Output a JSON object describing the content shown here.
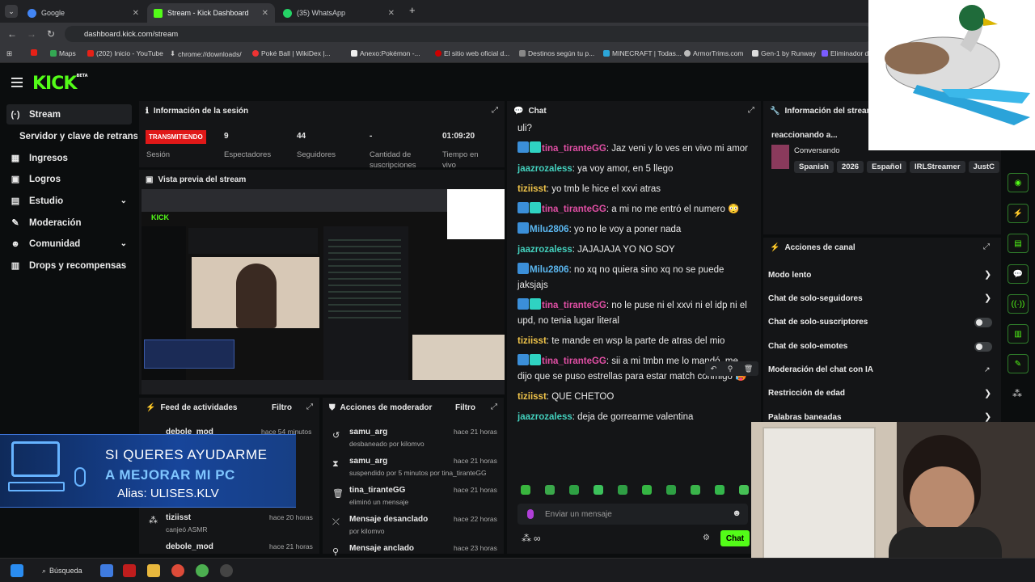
{
  "browser": {
    "tabs": [
      {
        "label": "Google",
        "color": "#4285f4"
      },
      {
        "label": "Stream - Kick Dashboard",
        "color": "#53fc18"
      },
      {
        "label": "(35) WhatsApp",
        "color": "#25d366"
      }
    ],
    "new_tab": "+",
    "url": "dashboard.kick.com/stream",
    "bookmarks": [
      "Maps",
      "(202) Inicio - YouTube",
      "chrome://downloads/",
      "Poké Ball | WikiDex |...",
      "Anexo:Pokémon -...",
      "El sitio web oficial d...",
      "Destinos según tu p...",
      "MINECRAFT | Todas...",
      "ArmorTrims.com",
      "Gen-1 by Runway",
      "Eliminador d"
    ]
  },
  "kick": {
    "logo": "KICK",
    "logo_badge": "BETA",
    "sidebar": [
      {
        "label": "Stream",
        "icon": "(·)"
      },
      {
        "label": "Servidor y clave de retransmisión",
        "icon": ""
      },
      {
        "label": "Ingresos",
        "icon": "▦"
      },
      {
        "label": "Logros",
        "icon": "▣"
      },
      {
        "label": "Estudio",
        "icon": "▤",
        "chevron": "⌄"
      },
      {
        "label": "Moderación",
        "icon": "✎"
      },
      {
        "label": "Comunidad",
        "icon": "☻",
        "chevron": "⌄"
      },
      {
        "label": "Drops y recompensas",
        "icon": "▥"
      }
    ],
    "session": {
      "title": "Información de la sesión",
      "live_label": "TRANSMITIENDO",
      "session_label": "Sesión",
      "stats": [
        {
          "value": "9",
          "label": "Espectadores"
        },
        {
          "value": "44",
          "label": "Seguidores"
        },
        {
          "value": "-",
          "label": "Cantidad de suscripciones"
        },
        {
          "value": "01:09:20",
          "label": "Tiempo en vivo"
        }
      ]
    },
    "preview": {
      "title": "Vista previa del stream"
    },
    "chat": {
      "title": "Chat",
      "messages": [
        {
          "user": "",
          "text": "uli?",
          "cls": "",
          "badges": 0
        },
        {
          "user": "tina_tiranteGG",
          "text": "Jaz veni y lo ves en vivo mi amor",
          "cls": "u-pink",
          "badges": 2
        },
        {
          "user": "jaazrozaless",
          "text": "ya voy amor, en 5 llego",
          "cls": "u-teal",
          "badges": 0
        },
        {
          "user": "tiziisst",
          "text": "yo tmb le hice el xxvi atras",
          "cls": "u-yel",
          "badges": 0
        },
        {
          "user": "tina_tiranteGG",
          "text": "a mi no me entró el numero 😳",
          "cls": "u-pink",
          "badges": 2
        },
        {
          "user": "Milu2806",
          "text": "yo no le voy a poner nada",
          "cls": "u-blue",
          "badges": 1
        },
        {
          "user": "jaazrozaless",
          "text": "JAJAJAJA YO NO SOY",
          "cls": "u-teal",
          "badges": 0
        },
        {
          "user": "Milu2806",
          "text": "no xq no quiera sino xq no se puede jaksjajs",
          "cls": "u-blue",
          "badges": 1
        },
        {
          "user": "tina_tiranteGG",
          "text": "no le puse ni el xxvi ni el idp ni el upd, no tenia lugar literal",
          "cls": "u-pink",
          "badges": 2
        },
        {
          "user": "tiziisst",
          "text": "te mande en wsp la parte de atras del mio",
          "cls": "u-yel",
          "badges": 0
        },
        {
          "user": "tina_tiranteGG",
          "text": "sii a mi tmbn me lo mandó, me dijo que se puso estrellas para estar match conmigo 🥵",
          "cls": "u-pink",
          "badges": 2
        },
        {
          "user": "tiziisst",
          "text": "QUE CHETOO",
          "cls": "u-yel",
          "badges": 0
        },
        {
          "user": "jaazrozaless",
          "text": "deja de gorrearme valentina",
          "cls": "u-teal",
          "badges": 0
        }
      ],
      "input_placeholder": "Enviar un mensaje",
      "send_label": "Chat",
      "infinity": "∞"
    },
    "stream_info": {
      "title": "Información del stream",
      "stream_title": "reaccionando a...",
      "category": "Conversando",
      "tags": [
        "Spanish",
        "2026",
        "Español",
        "IRLStreamer",
        "JustC"
      ]
    },
    "channel_actions": {
      "title": "Acciones de canal",
      "items": [
        {
          "label": "Modo lento",
          "control": "chevron"
        },
        {
          "label": "Chat de solo-seguidores",
          "control": "chevron"
        },
        {
          "label": "Chat de solo-suscriptores",
          "control": "toggle"
        },
        {
          "label": "Chat de solo-emotes",
          "control": "toggle"
        },
        {
          "label": "Moderación del chat con IA",
          "control": "link"
        },
        {
          "label": "Restricción de edad",
          "control": "chevron"
        },
        {
          "label": "Palabras baneadas",
          "control": "chevron"
        }
      ]
    },
    "activity_feed": {
      "title": "Feed de actividades",
      "filter": "Filtro",
      "items": [
        {
          "user": "debole_mod",
          "sub": "",
          "time": "hace 54 minutos"
        },
        {
          "user": "tiziisst",
          "sub": "canjeó ASMR",
          "time": "hace 20 horas"
        },
        {
          "user": "debole_mod",
          "sub": "",
          "time": "hace 21 horas"
        }
      ]
    },
    "mod_actions": {
      "title": "Acciones de moderador",
      "filter": "Filtro",
      "items": [
        {
          "user": "samu_arg",
          "sub": "desbaneado por kilomvo",
          "time": "hace 21 horas"
        },
        {
          "user": "samu_arg",
          "sub": "suspendido por 5 minutos por tina_tiranteGG",
          "time": "hace 21 horas"
        },
        {
          "user": "tina_tiranteGG",
          "sub": "eliminó un mensaje",
          "time": "hace 21 horas"
        },
        {
          "user": "Mensaje desanclado",
          "sub": "por kilomvo",
          "time": "hace 22 horas"
        },
        {
          "user": "Mensaje anclado",
          "sub": "",
          "time": "hace 23 horas"
        }
      ]
    }
  },
  "overlay": {
    "line1": "SI QUERES AYUDARME",
    "line2": "A MEJORAR MI PC",
    "line3": "Alias: ULISES.KLV"
  },
  "taskbar": {
    "search": "Búsqueda"
  }
}
